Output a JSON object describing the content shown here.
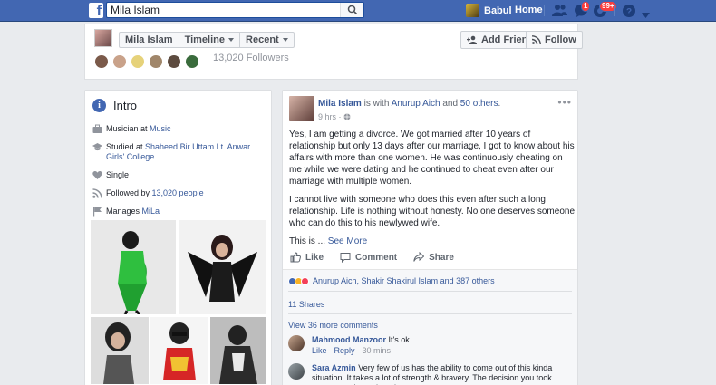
{
  "colors": {
    "brand": "#4267b2",
    "link": "#365899",
    "badge": "#fa3e3e"
  },
  "topbar": {
    "search_value": "Mila Islam",
    "user_name": "Babul",
    "home_label": "Home",
    "friend_badge": "",
    "message_badge": "1",
    "notification_badge": "99+",
    "icons": [
      "facebook-logo-icon",
      "search-icon",
      "friend-requests-icon",
      "messages-icon",
      "notifications-icon",
      "help-icon",
      "account-menu-icon"
    ]
  },
  "profile_header": {
    "name": "Mila Islam",
    "timeline_label": "Timeline",
    "recent_label": "Recent",
    "add_friend_label": "Add Friend",
    "follow_label": "Follow",
    "followers_text": "13,020 Followers"
  },
  "intro": {
    "title": "Intro",
    "musician_prefix": "Musician at ",
    "musician_link": "Music",
    "studied_prefix": "Studied at ",
    "studied_link": "Shaheed Bir Uttam Lt. Anwar Girls' College",
    "relationship": "Single",
    "followed_prefix": "Followed by ",
    "followed_link": "13,020 people",
    "manages_prefix": "Manages ",
    "manages_link": "MiLa"
  },
  "post": {
    "author": "Mila Islam",
    "with_text": " is with ",
    "tagged": "Anurup Aich",
    "and_text": " and ",
    "others": "50 others",
    "period": ".",
    "time": "9 hrs · ",
    "paragraph1": "Yes, I am getting a divorce. We got married after 10 years of relationship but only 13 days after our marriage, I got to know about his affairs with more than one women. He was continuously cheating on me while we were dating and he continued to cheat even after our marriage with multiple women.",
    "paragraph2": "I cannot live with someone who does this even after such a long relationship. Life is nothing without honesty. No one deserves someone who can do this to his newlywed wife.",
    "paragraph3_prefix": "This is ... ",
    "see_more": "See More",
    "like_label": "Like",
    "comment_label": "Comment",
    "share_label": "Share",
    "reactions_text": "Anurup Aich, Shakir Shakirul Islam and 387 others",
    "shares_text": "11 Shares",
    "view_more_comments": "View 36 more comments",
    "comments": [
      {
        "author": "Mahmood Manzoor",
        "text": " It's ok",
        "like": "Like",
        "reply": "Reply",
        "time": "30 mins"
      },
      {
        "author": "Sara Azmin",
        "text": " Very few of us has the ability to come out of this kinda situation. It takes a lot of strength & bravery. The decision you took proves you have them in"
      }
    ]
  }
}
